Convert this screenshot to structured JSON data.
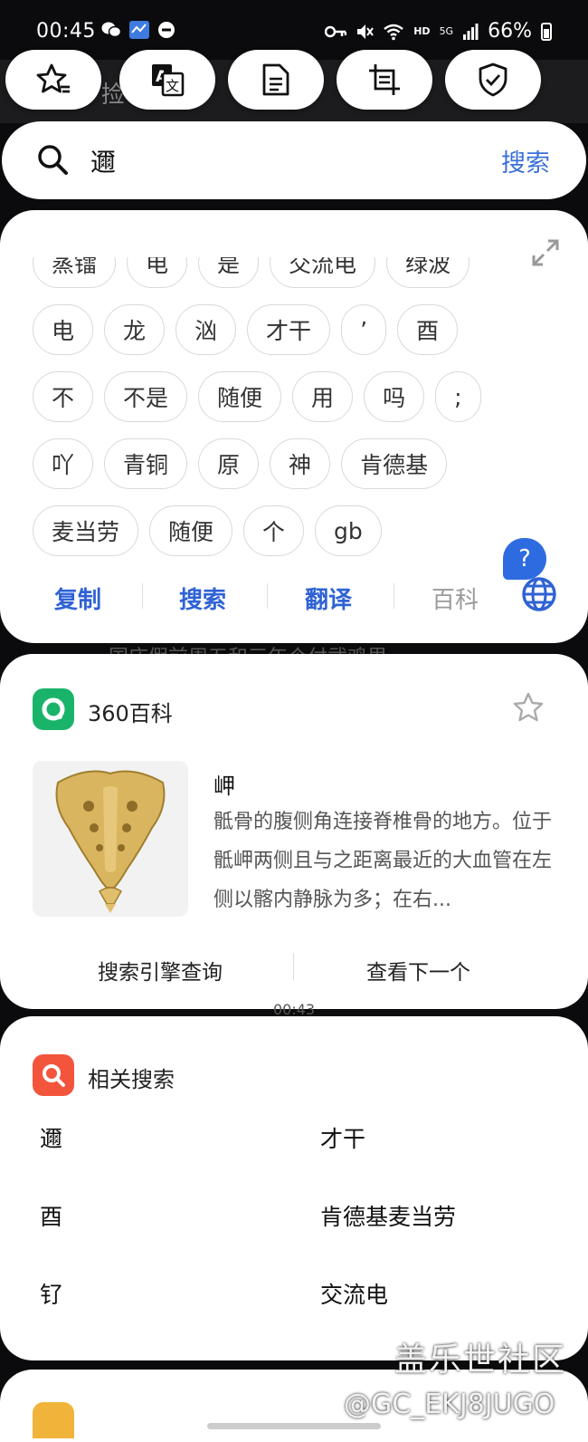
{
  "status": {
    "time": "00:45",
    "net": "HD",
    "signal": "5G",
    "battery": "66%"
  },
  "background": {
    "behind_text": "捡",
    "peek_text": "国庆假前周五和三年个付武鸡里",
    "peek_time": "00:43"
  },
  "toolbar": {
    "icons": [
      "star-list-icon",
      "translate-icon",
      "document-icon",
      "crop-text-icon",
      "shield-check-icon"
    ]
  },
  "search": {
    "query": "邇",
    "button": "搜索"
  },
  "tokens": {
    "rows": [
      [
        "蒸镭",
        "电",
        "是",
        "交流电",
        "绿波"
      ],
      [
        "电",
        "龙",
        "汹",
        "才干",
        "’",
        "酉"
      ],
      [
        "不",
        "不是",
        "随便",
        "用",
        "吗",
        ";"
      ],
      [
        "吖",
        "青铜",
        "原",
        "神",
        "肯德基"
      ],
      [
        "麦当劳",
        "随便",
        "个",
        "gb"
      ]
    ],
    "help": "?",
    "actions": {
      "copy": "复制",
      "search": "搜索",
      "translate": "翻译",
      "encyclopedia": "百科"
    }
  },
  "baike": {
    "source": "360百科",
    "entry_title": "岬",
    "entry_desc": "骶骨的腹侧角连接脊椎骨的地方。位于骶岬两侧且与之距离最近的大血管在左侧以髂内静脉为多；在右...",
    "footer": {
      "left": "搜索引擎查询",
      "right": "查看下一个"
    }
  },
  "related": {
    "title": "相关搜索",
    "items": [
      "邇",
      "才干",
      "酉",
      "肯德基麦当劳",
      "钌",
      "交流电"
    ]
  },
  "watermark": {
    "line1": "盖乐世社区",
    "line2": "@GC_EKJ8JUGO"
  },
  "colors": {
    "accent": "#2f62d4",
    "baike_green": "#19b46a",
    "related_red": "#f2553c"
  }
}
